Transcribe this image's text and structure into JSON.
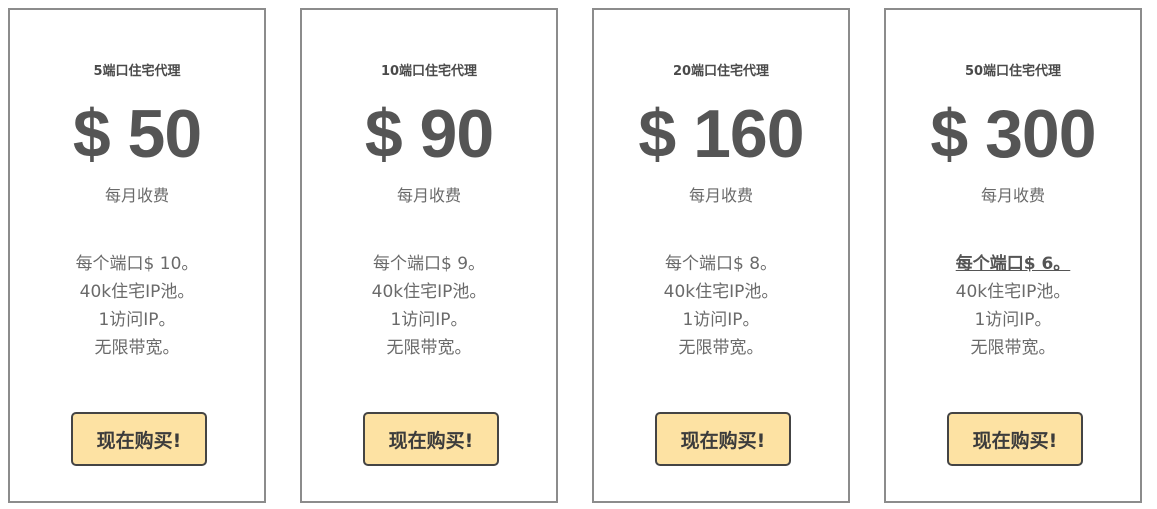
{
  "plans": [
    {
      "title": "5端口住宅代理",
      "price": "$ 50",
      "period": "每月收费",
      "features": [
        "每个端口$ 10。",
        "40k住宅IP池。",
        "1访问IP。",
        "无限带宽。"
      ],
      "button_label": "现在购买!"
    },
    {
      "title": "10端口住宅代理",
      "price": "$ 90",
      "period": "每月收费",
      "features": [
        "每个端口$ 9。",
        "40k住宅IP池。",
        "1访问IP。",
        "无限带宽。"
      ],
      "button_label": "现在购买!"
    },
    {
      "title": "20端口住宅代理",
      "price": "$ 160",
      "period": "每月收费",
      "features": [
        "每个端口$ 8。",
        "40k住宅IP池。",
        "1访问IP。",
        "无限带宽。"
      ],
      "button_label": "现在购买!"
    },
    {
      "title": "50端口住宅代理",
      "price": "$ 300",
      "period": "每月收费",
      "features": [
        "每个端口$ 6。",
        "40k住宅IP池。",
        "1访问IP。",
        "无限带宽。"
      ],
      "button_label": "现在购买!"
    }
  ],
  "colors": {
    "button_bg": "#fde2a3",
    "card_border": "#8c8c8c",
    "text": "#5a5a5a"
  }
}
